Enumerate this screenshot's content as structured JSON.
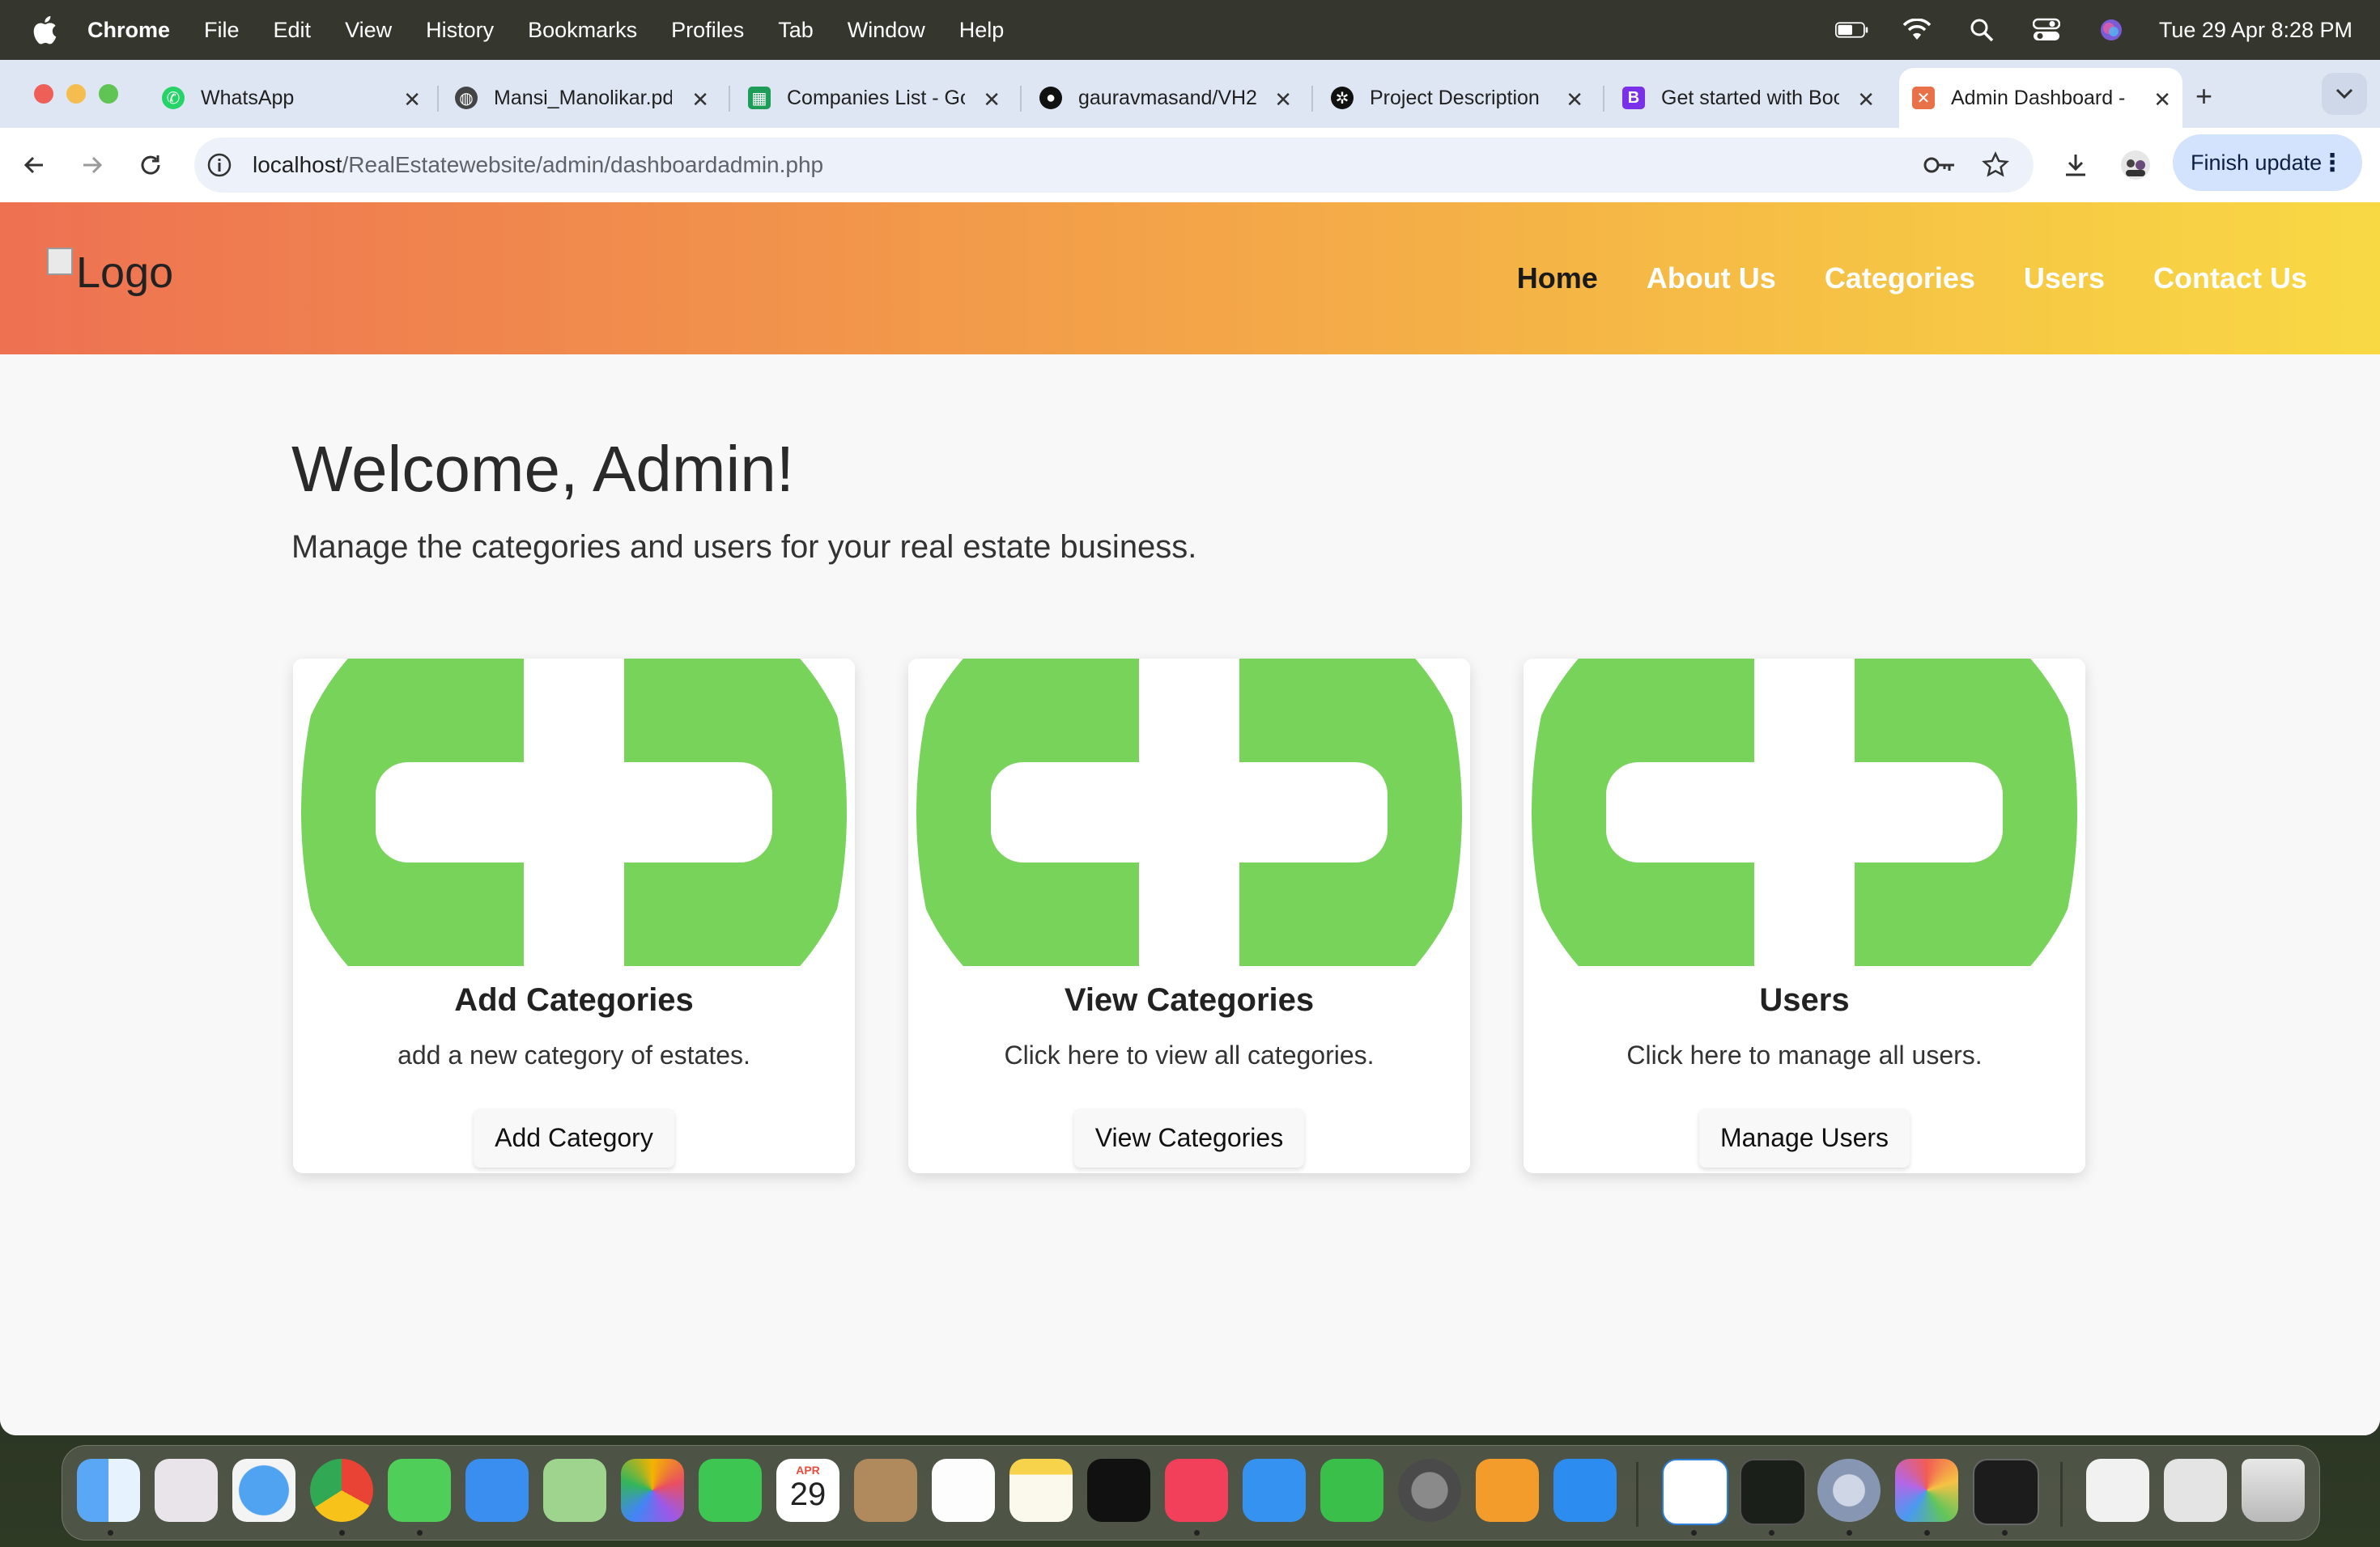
{
  "menubar": {
    "app": "Chrome",
    "items": [
      "File",
      "Edit",
      "View",
      "History",
      "Bookmarks",
      "Profiles",
      "Tab",
      "Window",
      "Help"
    ],
    "datetime": "Tue 29 Apr  8:28 PM"
  },
  "tabs": [
    {
      "label": "WhatsApp",
      "icon": "whatsapp-icon",
      "color": "#25d366"
    },
    {
      "label": "Mansi_Manolikar.pdf",
      "icon": "globe-icon",
      "color": "#444444"
    },
    {
      "label": "Companies List - Google Sheets",
      "icon": "sheets-icon",
      "color": "#1e9d58"
    },
    {
      "label": "gauravmasand/VH2",
      "icon": "github-icon",
      "color": "#111111"
    },
    {
      "label": "Project Description",
      "icon": "openai-icon",
      "color": "#111111"
    },
    {
      "label": "Get started with Bootstrap",
      "icon": "bootstrap-icon",
      "color": "#7a2fe8"
    },
    {
      "label": "Admin Dashboard - ",
      "icon": "xampp-icon",
      "color": "#e8714a",
      "active": true
    }
  ],
  "toolbar": {
    "url_host": "localhost",
    "url_path": "/RealEstatewebsite/admin/dashboardadmin.php",
    "finish_update": "Finish update"
  },
  "site": {
    "logo_alt": "Logo",
    "nav": [
      "Home",
      "About Us",
      "Categories",
      "Users",
      "Contact Us"
    ],
    "welcome": "Welcome, Admin!",
    "subtitle": "Manage the categories and users for your real estate business.",
    "cards": [
      {
        "title": "Add Categories",
        "text": "add a new category of estates.",
        "button": "Add Category"
      },
      {
        "title": "View Categories",
        "text": "Click here to view all categories.",
        "button": "View Categories"
      },
      {
        "title": "Users",
        "text": "Click here to manage all users.",
        "button": "Manage Users"
      }
    ]
  },
  "dock": {
    "apps": [
      "finder-icon",
      "launchpad-icon",
      "safari-icon",
      "chrome-icon",
      "messages-icon",
      "mail-icon",
      "maps-icon",
      "photos-icon",
      "facetime-icon",
      "calendar-icon",
      "contacts-icon",
      "reminders-icon",
      "notes-icon",
      "appletv-icon",
      "music-icon",
      "keynote-icon",
      "numbers-icon",
      "settings-icon",
      "pages-icon",
      "appstore-icon",
      "vscode-icon",
      "activity-monitor-icon",
      "system-prefs-icon",
      "xcode-icon",
      "terminal-icon",
      "documents-icon",
      "preview-icon",
      "trash-icon"
    ],
    "calendar_month": "APR",
    "calendar_day": "29"
  }
}
